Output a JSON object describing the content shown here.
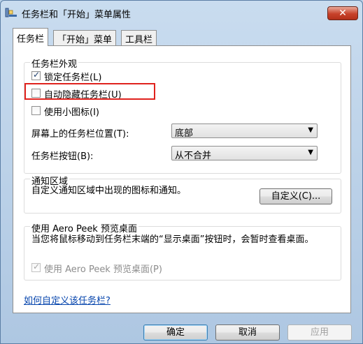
{
  "window": {
    "title": "任务栏和「开始」菜单属性",
    "close_label": "✕"
  },
  "tabs": [
    {
      "label": "任务栏",
      "active": true
    },
    {
      "label": "「开始」菜单",
      "active": false
    },
    {
      "label": "工具栏",
      "active": false
    }
  ],
  "appearance": {
    "title": "任务栏外观",
    "lock_label": "锁定任务栏(L)",
    "lock_checked": true,
    "autohide_label": "自动隐藏任务栏(U)",
    "autohide_checked": false,
    "small_icons_label": "使用小图标(I)",
    "small_icons_checked": false,
    "location_label": "屏幕上的任务栏位置(T):",
    "location_value": "底部",
    "buttons_label": "任务栏按钮(B):",
    "buttons_value": "从不合并"
  },
  "notification": {
    "title": "通知区域",
    "description": "自定义通知区域中出现的图标和通知。",
    "customize_label": "自定义(C)..."
  },
  "aero_peek": {
    "title": "使用 Aero Peek 预览桌面",
    "description": "当您将鼠标移动到任务栏末端的“显示桌面”按钮时，会暂时查看桌面。",
    "checkbox_label": "使用 Aero Peek 预览桌面(P)",
    "checked": true,
    "enabled": false
  },
  "help_link": "如何自定义该任务栏?",
  "buttons": {
    "ok": "确定",
    "cancel": "取消",
    "apply": "应用"
  },
  "colors": {
    "highlight": "#e0221d",
    "link": "#0645ad"
  }
}
